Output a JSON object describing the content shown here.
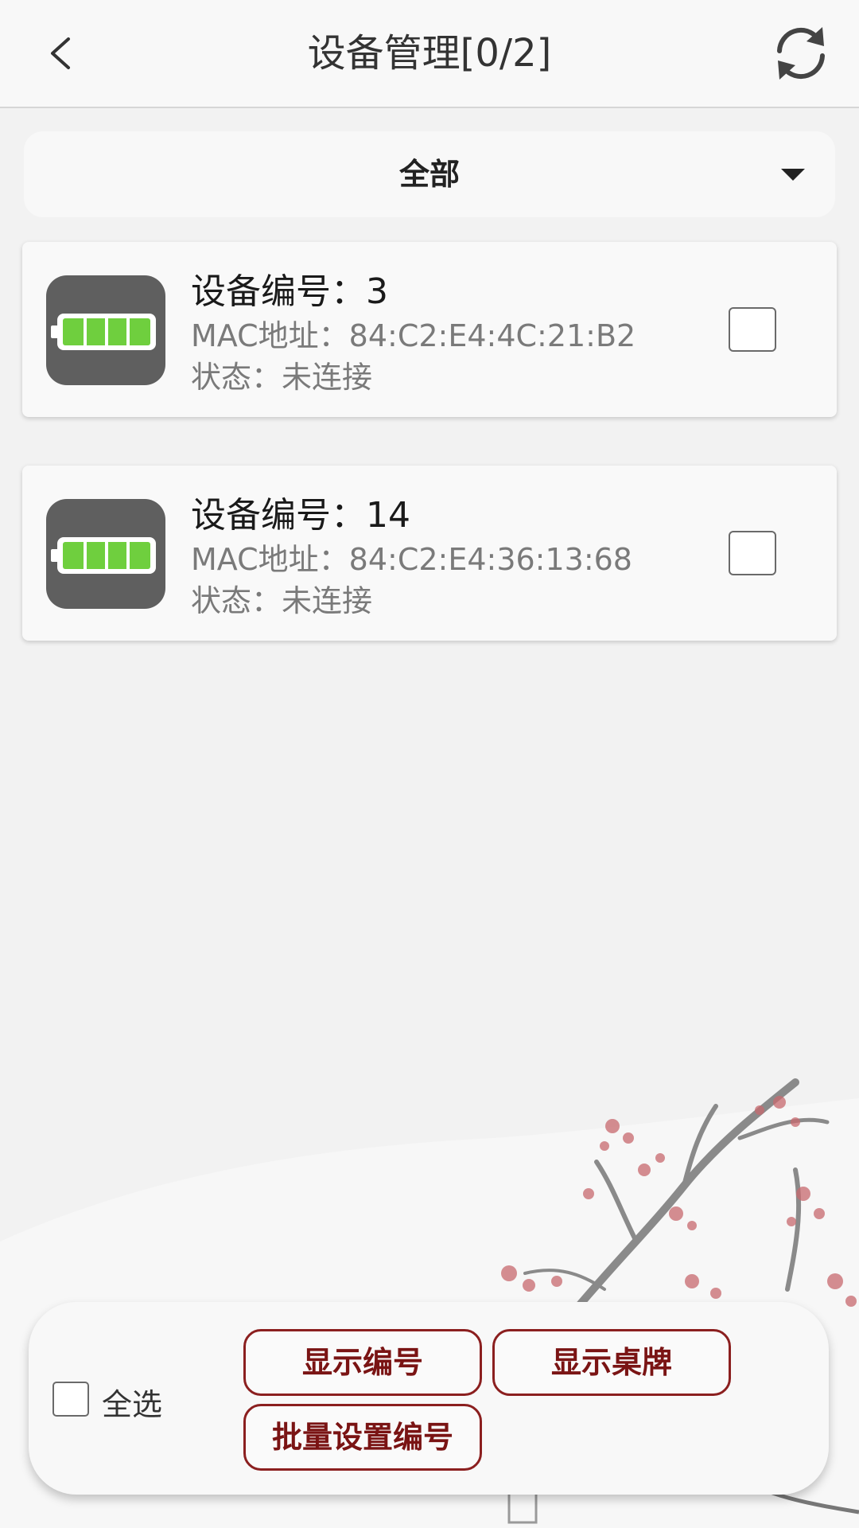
{
  "header": {
    "title": "设备管理[0/2]",
    "back_icon": "chevron-left-icon",
    "refresh_icon": "refresh-icon"
  },
  "filter": {
    "selected": "全部",
    "caret_icon": "caret-down-icon"
  },
  "devices": [
    {
      "id_label": "设备编号：",
      "id_value": "3",
      "mac_label": "MAC地址：",
      "mac_value": "84:C2:E4:4C:21:B2",
      "status_label": "状态：",
      "status_value": "未连接",
      "battery_level": 1.0,
      "checked": false
    },
    {
      "id_label": "设备编号：",
      "id_value": "14",
      "mac_label": "MAC地址：",
      "mac_value": "84:C2:E4:36:13:68",
      "status_label": "状态：",
      "status_value": "未连接",
      "battery_level": 1.0,
      "checked": false
    }
  ],
  "bottom_panel": {
    "select_all_label": "全选",
    "select_all_checked": false,
    "buttons": {
      "show_number": "显示编号",
      "show_nameplate": "显示桌牌",
      "batch_set_number": "批量设置编号"
    }
  },
  "colors": {
    "battery_green": "#7ed348",
    "icon_background": "#5f5f5f",
    "button_border": "#8b1f1f",
    "button_text": "#7a1414",
    "blossom": "#c8696e"
  }
}
